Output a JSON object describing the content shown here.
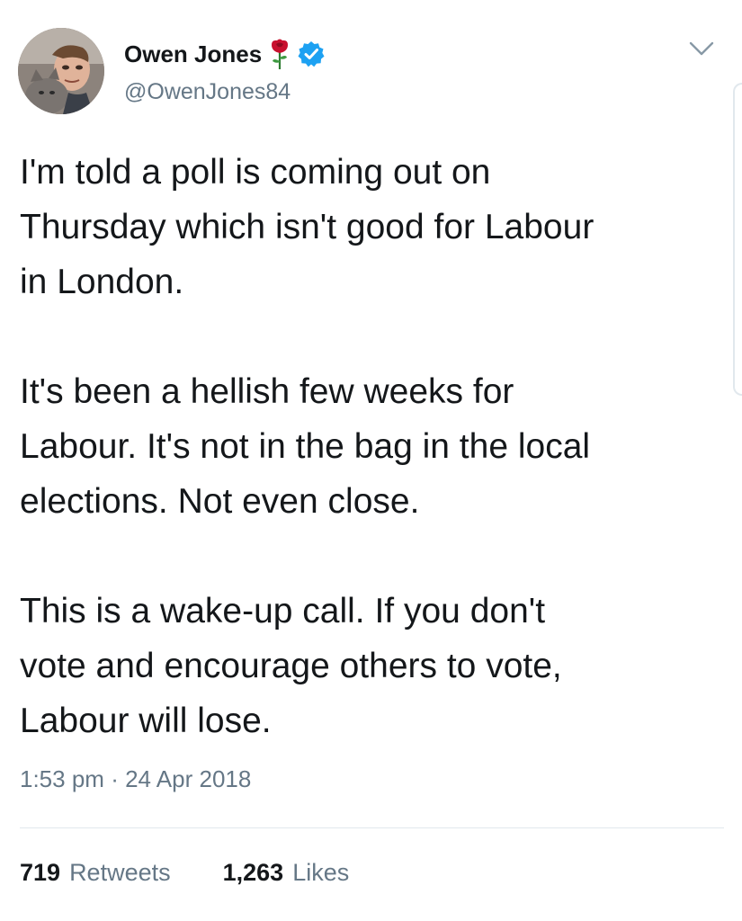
{
  "author": {
    "display_name": "Owen Jones",
    "handle": "@OwenJones84",
    "badges": [
      "rose-emoji",
      "verified-badge"
    ]
  },
  "tweet": {
    "text": "I'm told a poll is coming out on\nThursday which isn't good for Labour\nin London.\n\nIt's been a hellish few weeks for\nLabour. It's not in the bag in the local\nelections. Not even close.\n\nThis is a wake-up call. If you don't\nvote and encourage others to vote,\nLabour will lose.",
    "time": "1:53 pm",
    "separator": "·",
    "date": "24 Apr 2018"
  },
  "stats": {
    "retweets_count": "719",
    "retweets_label": "Retweets",
    "likes_count": "1,263",
    "likes_label": "Likes"
  },
  "icons": {
    "menu": "chevron-down-icon",
    "verified": "verified-icon",
    "rose": "rose-icon"
  },
  "colors": {
    "verified_blue": "#1da1f2",
    "secondary_text": "#657786",
    "rose_red": "#c8102e"
  }
}
